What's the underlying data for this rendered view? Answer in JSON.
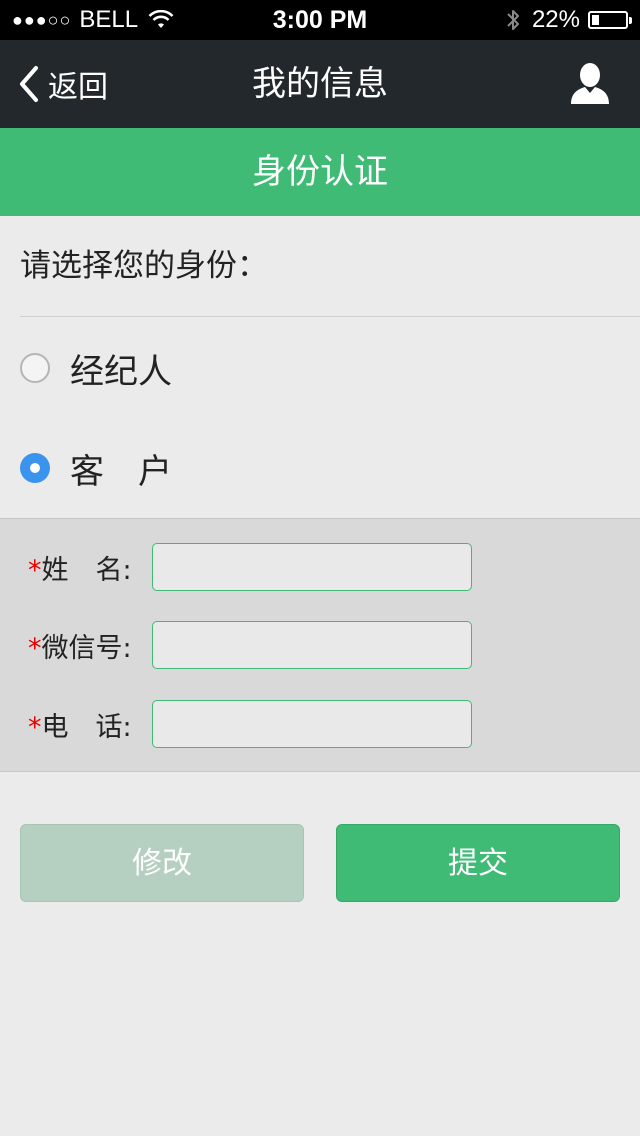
{
  "status_bar": {
    "signal": "●●●○○",
    "carrier": "BELL",
    "time": "3:00 PM",
    "battery_percent": "22%",
    "battery_level": 0.22,
    "icons": [
      "signal-dots",
      "wifi-icon",
      "bluetooth-icon",
      "battery-icon"
    ]
  },
  "nav": {
    "back_label": "返回",
    "title": "我的信息",
    "icons": [
      "back-chevron-icon",
      "user-icon"
    ]
  },
  "section": {
    "title": "身份认证"
  },
  "identity": {
    "prompt": "请选择您的身份：",
    "options": [
      {
        "label": "经纪人",
        "selected": false
      },
      {
        "label": "客　户",
        "selected": true
      }
    ]
  },
  "form": {
    "required_mark": "*",
    "fields": [
      {
        "label": "姓　名:",
        "value": "",
        "placeholder": ""
      },
      {
        "label": "微信号:",
        "value": "",
        "placeholder": ""
      },
      {
        "label": "电　话:",
        "value": "",
        "placeholder": ""
      }
    ]
  },
  "buttons": {
    "modify": "修改",
    "submit": "提交"
  },
  "colors": {
    "accent_green": "#40bb75",
    "nav_background": "#22282c",
    "radio_selected": "#3a94ee",
    "required_red": "#e60000",
    "disabled_button": "#b5cfc0"
  }
}
